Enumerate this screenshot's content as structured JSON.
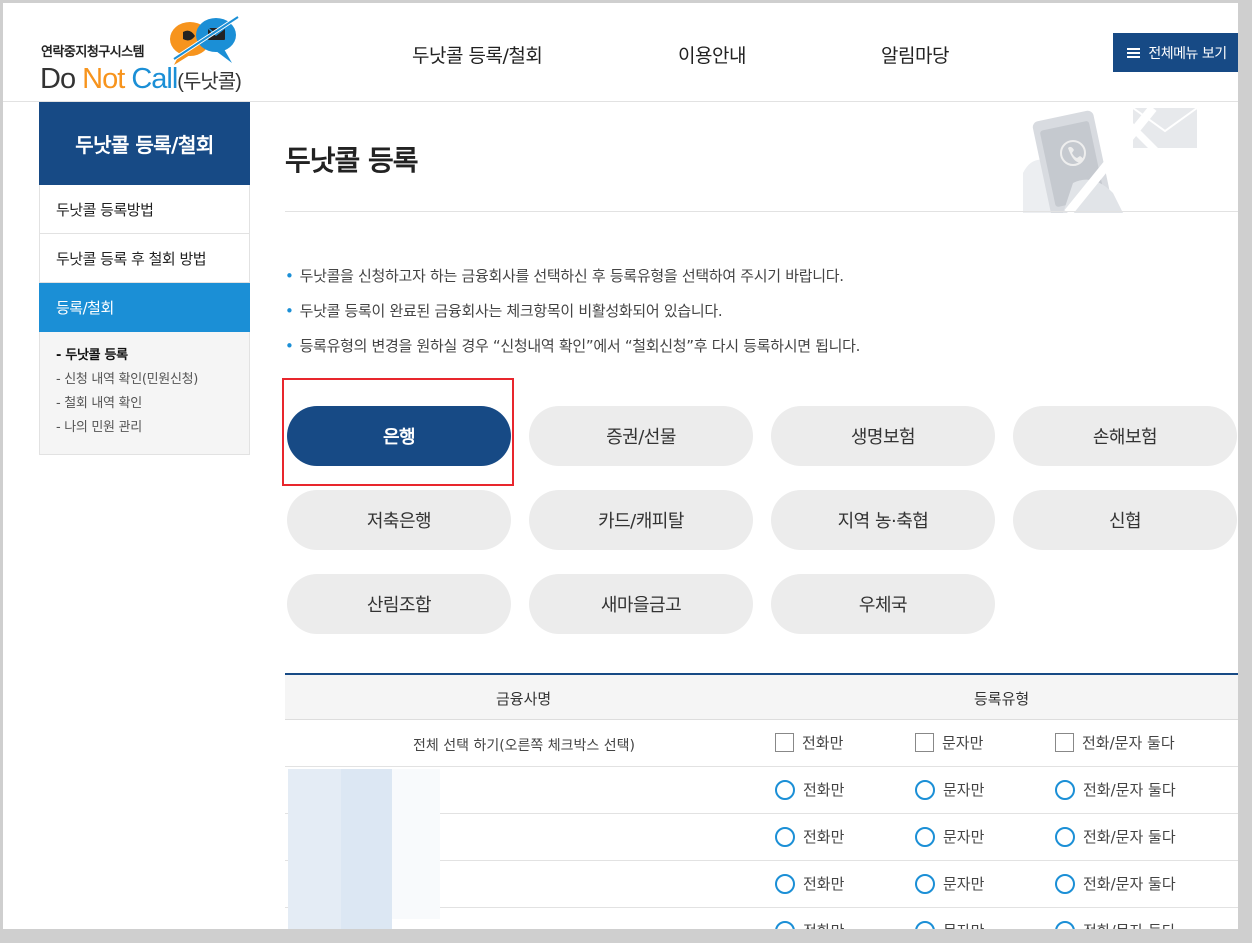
{
  "header": {
    "logo_sub": "연락중지청구시스템",
    "logo_do": "Do ",
    "logo_not": "Not ",
    "logo_call": "Call",
    "logo_kr": "(두낫콜)",
    "nav": [
      "두낫콜 등록/철회",
      "이용안내",
      "알림마당"
    ],
    "all_menu": "전체메뉴 보기"
  },
  "sidebar": {
    "title": "두낫콜 등록/철회",
    "items": [
      {
        "label": "두낫콜 등록방법",
        "active": false
      },
      {
        "label": "두낫콜 등록 후 철회 방법",
        "active": false
      },
      {
        "label": "등록/철회",
        "active": true
      }
    ],
    "sub_items": [
      {
        "label": "- 두낫콜 등록",
        "active": true
      },
      {
        "label": "- 신청 내역 확인(민원신청)",
        "active": false
      },
      {
        "label": "- 철회 내역 확인",
        "active": false
      },
      {
        "label": "- 나의 민원 관리",
        "active": false
      }
    ]
  },
  "main": {
    "title": "두낫콜 등록",
    "notes": [
      "두낫콜을 신청하고자 하는 금융회사를 선택하신 후 등록유형을 선택하여 주시기 바랍니다.",
      "두낫콜 등록이 완료된 금융회사는 체크항목이 비활성화되어 있습니다.",
      "등록유형의 변경을 원하실 경우 “신청내역 확인”에서 “철회신청”후 다시 등록하시면 됩니다."
    ],
    "categories": [
      {
        "label": "은행",
        "selected": true
      },
      {
        "label": "증권/선물",
        "selected": false
      },
      {
        "label": "생명보험",
        "selected": false
      },
      {
        "label": "손해보험",
        "selected": false
      },
      {
        "label": "저축은행",
        "selected": false
      },
      {
        "label": "카드/캐피탈",
        "selected": false
      },
      {
        "label": "지역 농·축협",
        "selected": false
      },
      {
        "label": "신협",
        "selected": false
      },
      {
        "label": "산림조합",
        "selected": false
      },
      {
        "label": "새마을금고",
        "selected": false
      },
      {
        "label": "우체국",
        "selected": false
      }
    ]
  },
  "table": {
    "col_company": "금융사명",
    "col_type": "등록유형",
    "select_all_label": "전체 선택 하기(오른쪽 체크박스 선택)",
    "options": [
      "전화만",
      "문자만",
      "전화/문자 둘다"
    ],
    "rows": [
      {
        "company": "",
        "options": [
          "전화만",
          "문자만",
          "전화/문자 둘다"
        ]
      },
      {
        "company": "",
        "options": [
          "전화만",
          "문자만",
          "전화/문자 둘다"
        ]
      },
      {
        "company": "",
        "options": [
          "전화만",
          "문자만",
          "전화/문자 둘다"
        ]
      },
      {
        "company": "",
        "options": [
          "전화만",
          "문자만",
          "전화/문자 둘다"
        ]
      }
    ]
  },
  "colors": {
    "navy": "#174a85",
    "blue": "#1b8fd6",
    "orange": "#f7941d",
    "highlight_red": "#e8262d"
  }
}
